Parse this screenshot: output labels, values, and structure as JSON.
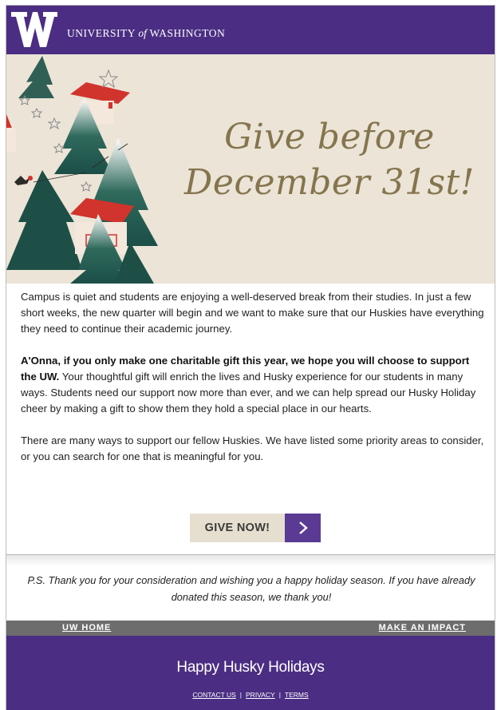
{
  "header": {
    "logo_letter": "W",
    "wordmark_pre": "UNIVERSITY ",
    "wordmark_of": "of",
    "wordmark_post": " WASHINGTON"
  },
  "hero": {
    "headline_line1": "Give before",
    "headline_line2": "December 31st!"
  },
  "body": {
    "p1": "Campus is quiet and students are enjoying a well-deserved break from their studies. In just a few short weeks, the new quarter will begin and we want to make sure that our Huskies have everything they need to continue their academic journey.",
    "p2_bold": "A'Onna, if you only make one charitable gift this year, we hope you will choose to support the UW.",
    "p2_rest": " Your thoughtful gift will enrich the lives and Husky experience for our students in many ways. Students need our support now more than ever, and we can help spread our Husky Holiday cheer by making a gift to show them they hold a special place in our hearts.",
    "p3": "There are many ways to support our fellow Huskies. We have listed some priority areas to consider, or you can search for one that is meaningful for you."
  },
  "cta": {
    "label": "GIVE NOW!",
    "arrow_icon": "chevron-right-icon"
  },
  "ps": "P.S. Thank you for your consideration and wishing you a happy holiday season. If you have already donated this season, we thank you!",
  "nav": {
    "left": "UW HOME",
    "right": "MAKE AN IMPACT"
  },
  "footer": {
    "title": "Happy Husky Holidays",
    "contact": "CONTACT US",
    "privacy": "PRIVACY",
    "terms": "TERMS",
    "separator": "|"
  },
  "colors": {
    "uw_purple": "#4b2e83",
    "gold": "#85754d",
    "hero_bg": "#ebe4d7",
    "cta_bg": "#e6dfd0",
    "cta_arrow_bg": "#5b3a93",
    "nav_gray": "#6d6d6d"
  }
}
